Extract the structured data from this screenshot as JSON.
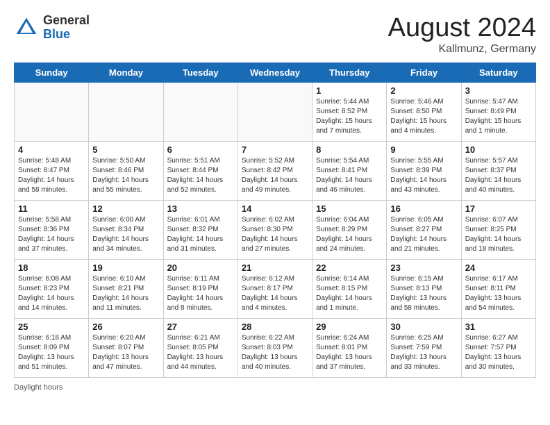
{
  "header": {
    "logo_general": "General",
    "logo_blue": "Blue",
    "month_year": "August 2024",
    "location": "Kallmunz, Germany"
  },
  "days_of_week": [
    "Sunday",
    "Monday",
    "Tuesday",
    "Wednesday",
    "Thursday",
    "Friday",
    "Saturday"
  ],
  "weeks": [
    [
      {
        "day": "",
        "info": ""
      },
      {
        "day": "",
        "info": ""
      },
      {
        "day": "",
        "info": ""
      },
      {
        "day": "",
        "info": ""
      },
      {
        "day": "1",
        "info": "Sunrise: 5:44 AM\nSunset: 8:52 PM\nDaylight: 15 hours and 7 minutes."
      },
      {
        "day": "2",
        "info": "Sunrise: 5:46 AM\nSunset: 8:50 PM\nDaylight: 15 hours and 4 minutes."
      },
      {
        "day": "3",
        "info": "Sunrise: 5:47 AM\nSunset: 8:49 PM\nDaylight: 15 hours and 1 minute."
      }
    ],
    [
      {
        "day": "4",
        "info": "Sunrise: 5:48 AM\nSunset: 8:47 PM\nDaylight: 14 hours and 58 minutes."
      },
      {
        "day": "5",
        "info": "Sunrise: 5:50 AM\nSunset: 8:46 PM\nDaylight: 14 hours and 55 minutes."
      },
      {
        "day": "6",
        "info": "Sunrise: 5:51 AM\nSunset: 8:44 PM\nDaylight: 14 hours and 52 minutes."
      },
      {
        "day": "7",
        "info": "Sunrise: 5:52 AM\nSunset: 8:42 PM\nDaylight: 14 hours and 49 minutes."
      },
      {
        "day": "8",
        "info": "Sunrise: 5:54 AM\nSunset: 8:41 PM\nDaylight: 14 hours and 46 minutes."
      },
      {
        "day": "9",
        "info": "Sunrise: 5:55 AM\nSunset: 8:39 PM\nDaylight: 14 hours and 43 minutes."
      },
      {
        "day": "10",
        "info": "Sunrise: 5:57 AM\nSunset: 8:37 PM\nDaylight: 14 hours and 40 minutes."
      }
    ],
    [
      {
        "day": "11",
        "info": "Sunrise: 5:58 AM\nSunset: 8:36 PM\nDaylight: 14 hours and 37 minutes."
      },
      {
        "day": "12",
        "info": "Sunrise: 6:00 AM\nSunset: 8:34 PM\nDaylight: 14 hours and 34 minutes."
      },
      {
        "day": "13",
        "info": "Sunrise: 6:01 AM\nSunset: 8:32 PM\nDaylight: 14 hours and 31 minutes."
      },
      {
        "day": "14",
        "info": "Sunrise: 6:02 AM\nSunset: 8:30 PM\nDaylight: 14 hours and 27 minutes."
      },
      {
        "day": "15",
        "info": "Sunrise: 6:04 AM\nSunset: 8:29 PM\nDaylight: 14 hours and 24 minutes."
      },
      {
        "day": "16",
        "info": "Sunrise: 6:05 AM\nSunset: 8:27 PM\nDaylight: 14 hours and 21 minutes."
      },
      {
        "day": "17",
        "info": "Sunrise: 6:07 AM\nSunset: 8:25 PM\nDaylight: 14 hours and 18 minutes."
      }
    ],
    [
      {
        "day": "18",
        "info": "Sunrise: 6:08 AM\nSunset: 8:23 PM\nDaylight: 14 hours and 14 minutes."
      },
      {
        "day": "19",
        "info": "Sunrise: 6:10 AM\nSunset: 8:21 PM\nDaylight: 14 hours and 11 minutes."
      },
      {
        "day": "20",
        "info": "Sunrise: 6:11 AM\nSunset: 8:19 PM\nDaylight: 14 hours and 8 minutes."
      },
      {
        "day": "21",
        "info": "Sunrise: 6:12 AM\nSunset: 8:17 PM\nDaylight: 14 hours and 4 minutes."
      },
      {
        "day": "22",
        "info": "Sunrise: 6:14 AM\nSunset: 8:15 PM\nDaylight: 14 hours and 1 minute."
      },
      {
        "day": "23",
        "info": "Sunrise: 6:15 AM\nSunset: 8:13 PM\nDaylight: 13 hours and 58 minutes."
      },
      {
        "day": "24",
        "info": "Sunrise: 6:17 AM\nSunset: 8:11 PM\nDaylight: 13 hours and 54 minutes."
      }
    ],
    [
      {
        "day": "25",
        "info": "Sunrise: 6:18 AM\nSunset: 8:09 PM\nDaylight: 13 hours and 51 minutes."
      },
      {
        "day": "26",
        "info": "Sunrise: 6:20 AM\nSunset: 8:07 PM\nDaylight: 13 hours and 47 minutes."
      },
      {
        "day": "27",
        "info": "Sunrise: 6:21 AM\nSunset: 8:05 PM\nDaylight: 13 hours and 44 minutes."
      },
      {
        "day": "28",
        "info": "Sunrise: 6:22 AM\nSunset: 8:03 PM\nDaylight: 13 hours and 40 minutes."
      },
      {
        "day": "29",
        "info": "Sunrise: 6:24 AM\nSunset: 8:01 PM\nDaylight: 13 hours and 37 minutes."
      },
      {
        "day": "30",
        "info": "Sunrise: 6:25 AM\nSunset: 7:59 PM\nDaylight: 13 hours and 33 minutes."
      },
      {
        "day": "31",
        "info": "Sunrise: 6:27 AM\nSunset: 7:57 PM\nDaylight: 13 hours and 30 minutes."
      }
    ]
  ],
  "footer": {
    "daylight_label": "Daylight hours"
  }
}
